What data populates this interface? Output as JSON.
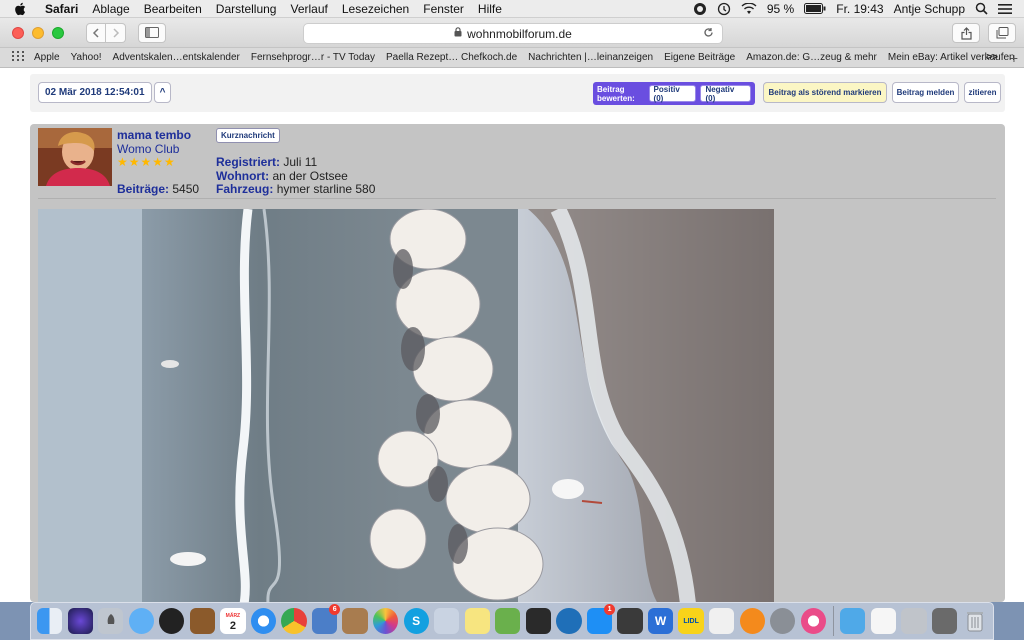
{
  "menubar": {
    "app": "Safari",
    "items": [
      "Ablage",
      "Bearbeiten",
      "Darstellung",
      "Verlauf",
      "Lesezeichen",
      "Fenster",
      "Hilfe"
    ],
    "battery": "95 %",
    "clock": "Fr. 19:43",
    "user": "Antje Schupp"
  },
  "browser": {
    "url": "wohnmobilforum.de",
    "bookmarks": [
      "Apple",
      "Yahoo!",
      "Adventskalen…entskalender",
      "Fernsehprogr…r - TV Today",
      "Paella Rezept… Chefkoch.de",
      "Nachrichten |…leinanzeigen",
      "Eigene Beiträge",
      "Amazon.de: G…zeug & mehr",
      "Mein eBay: Artikel verkaufen"
    ],
    "bookmarks_more": ">>"
  },
  "post": {
    "date": "02 Mär 2018 12:54:01",
    "up_label": "^",
    "rate_label": "Beitrag bewerten:",
    "positive_label": "Positiv (0)",
    "negative_label": "Negativ (0)",
    "disturbing_label": "Beitrag als störend markieren",
    "report_label": "Beitrag melden",
    "quote_label": "zitieren",
    "short_message_label": "Kurznachricht",
    "author": {
      "name": "mama tembo",
      "club": "Womo Club",
      "stars": "★★★★★",
      "posts_label": "Beiträge:",
      "posts_value": "5450",
      "registered_label": "Registriert:",
      "registered_value": "Juli 11",
      "location_label": "Wohnort:",
      "location_value": "an der Ostsee",
      "vehicle_label": "Fahrzeug:",
      "vehicle_value": "hymer starline 580"
    }
  },
  "dock": {
    "calendar_day": "2",
    "calendar_month": "MÄRZ",
    "badge_maps": "6",
    "badge_appstore": "1",
    "word_letter": "W",
    "lidl_label": "LIDL"
  },
  "colors": {
    "forum_blue": "#1e2f9a",
    "rating_purple": "#6a4ee0",
    "highlight_yellow": "#fbf6c4",
    "star_gold": "#ffb800"
  }
}
